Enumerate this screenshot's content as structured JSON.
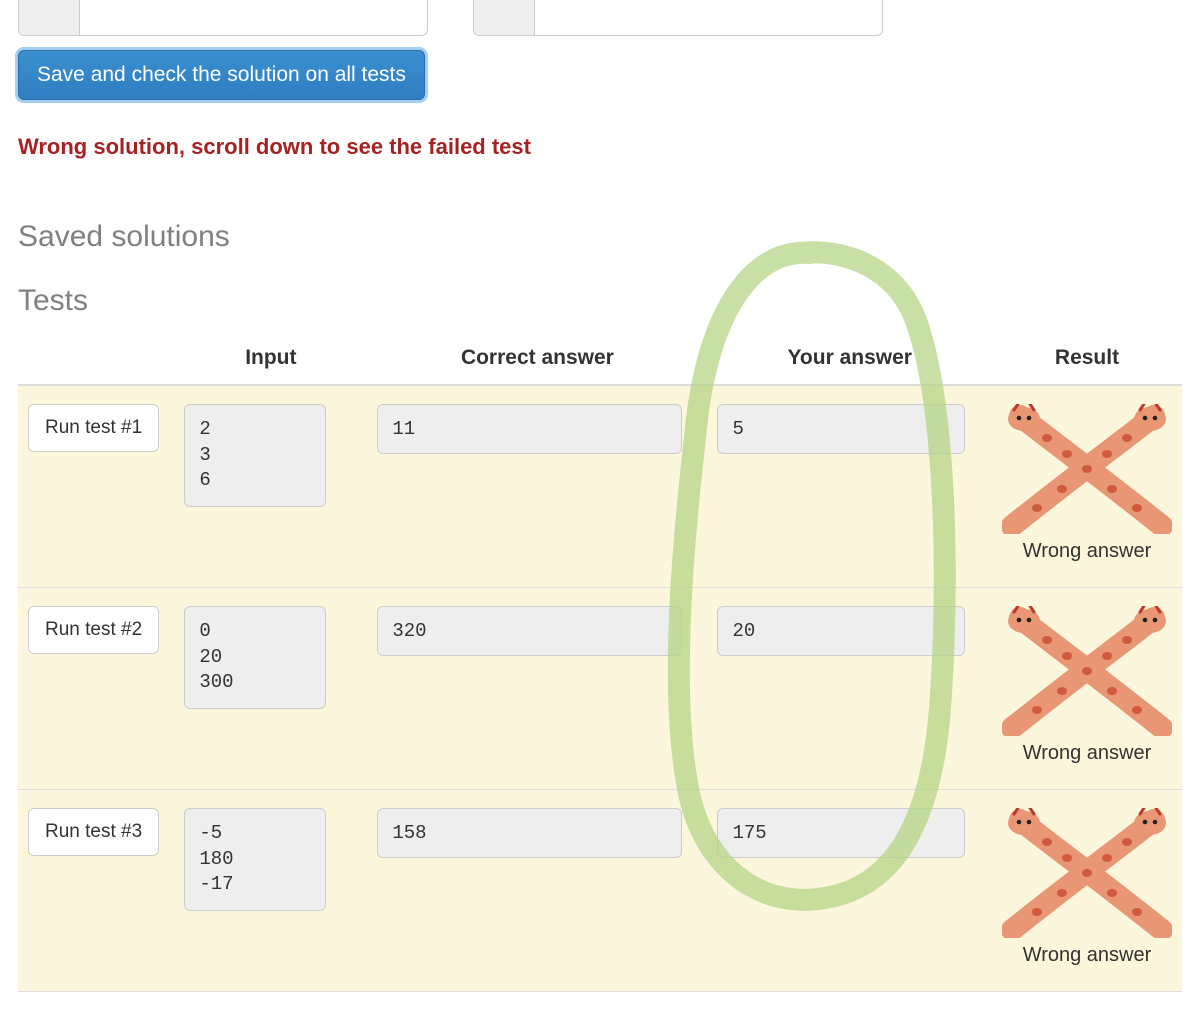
{
  "save_button": "Save and check the solution on all tests",
  "error_message": "Wrong solution, scroll down to see the failed test",
  "sections": {
    "saved": "Saved solutions",
    "tests": "Tests"
  },
  "table": {
    "headers": {
      "input": "Input",
      "correct": "Correct answer",
      "your": "Your answer",
      "result": "Result"
    },
    "rows": [
      {
        "run_label": "Run test #1",
        "input": "2\n3\n6",
        "correct": "11",
        "your": "5",
        "result": "Wrong answer"
      },
      {
        "run_label": "Run test #2",
        "input": "0\n20\n300",
        "correct": "320",
        "your": "20",
        "result": "Wrong answer"
      },
      {
        "run_label": "Run test #3",
        "input": "-5\n180\n-17",
        "correct": "158",
        "your": "175",
        "result": "Wrong answer"
      }
    ]
  }
}
